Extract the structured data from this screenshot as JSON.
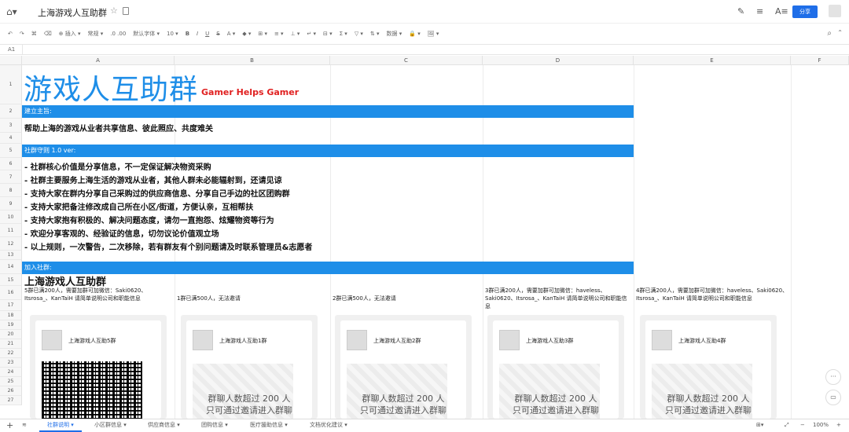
{
  "app": {
    "title": "上海游戏人互助群",
    "share_label": "分享"
  },
  "toolbar": {
    "insert": "⊕ 插入 ▾",
    "style": "常规 ▾",
    "decimal": ".0 .00",
    "font": "默认字体 ▾",
    "size": "10 ▾",
    "bold": "B",
    "italic": "I",
    "underline": "U",
    "strike": "S",
    "fontcolor": "A ▾",
    "fill": "◆ ▾",
    "border": "⊞ ▾",
    "align": "≡ ▾",
    "valign": "⊥ ▾",
    "wrap": "↵ ▾",
    "merge": "⊟ ▾",
    "sum": "Σ ▾",
    "filter": "▽ ▾",
    "sort": "⇅ ▾",
    "data": "数据 ▾",
    "lock": "🔒 ▾",
    "image": "🖼 ▾"
  },
  "formula_bar": {
    "cell_ref": "A1"
  },
  "columns": [
    "A",
    "B",
    "C",
    "D",
    "E",
    "F"
  ],
  "rows": [
    "1",
    "2",
    "3",
    "4",
    "5",
    "6",
    "7",
    "8",
    "9",
    "10",
    "11",
    "12",
    "13",
    "14",
    "15",
    "16",
    "17",
    "18",
    "19",
    "20",
    "21",
    "22",
    "23",
    "24",
    "25",
    "26",
    "27"
  ],
  "sheet": {
    "title": "游戏人互助群",
    "subtitle": "Gamer Helps Gamer",
    "purpose_header": "建立主旨:",
    "purpose": "帮助上海的游戏从业者共享信息、彼此照应、共度难关",
    "rules_header": "社群守则 1.0 ver:",
    "rules": [
      "- 社群核心价值是分享信息，不一定保证解决物资采购",
      "- 社群主要服务上海生活的游戏从业者，其他人群未必能辐射到，还请见谅",
      "- 支持大家在群内分享自己采购过的供应商信息、分享自己手边的社区团购群",
      "- 支持大家把备注修改成自己所在小区/街道，方便认亲，互相帮扶",
      "- 支持大家抱有积极的、解决问题态度，请勿一直抱怨、炫耀物资等行为",
      "- 欢迎分享客观的、经验证的信息，切勿议论价值观立场",
      "- 以上规则，一次警告，二次移除，若有群友有个别问题请及时联系管理员&志愿者"
    ],
    "join_header": "加入社群:",
    "group_title": "上海游戏人互助群",
    "notes": [
      "5群已满200人，需要加群可加微信：Saki0620、Itsrosa_、KanTaiH 请简单说明公司和职能信息",
      "1群已满500人，无法邀请",
      "2群已满500人，无法邀请",
      "3群已满200人，需要加群可加微信：haveless、Saki0620、Itsrosa_、KanTaiH 请简单说明公司和职能信息",
      "4群已满200人，需要加群可加微信：haveless、Saki0620、Itsrosa_、KanTaiH 请简单说明公司和职能信息"
    ],
    "cards": [
      {
        "name": "上海游戏人互助5群"
      },
      {
        "name": "上海游戏人互助1群",
        "expired": "群聊人数超过 200 人\n只可通过邀请进入群聊"
      },
      {
        "name": "上海游戏人互助2群",
        "expired": "群聊人数超过 200 人\n只可通过邀请进入群聊"
      },
      {
        "name": "上海游戏人互助3群",
        "expired": "群聊人数超过 200 人\n只可通过邀请进入群聊"
      },
      {
        "name": "上海游戏人互助4群",
        "expired": "群聊人数超过 200 人\n只可通过邀请进入群聊"
      }
    ]
  },
  "tabs": [
    "社群说明 ▾",
    "小区群信息 ▾",
    "供应商信息 ▾",
    "团购信息 ▾",
    "医疗援助信息 ▾",
    "文档优化建议 ▾"
  ],
  "zoom": "100%"
}
